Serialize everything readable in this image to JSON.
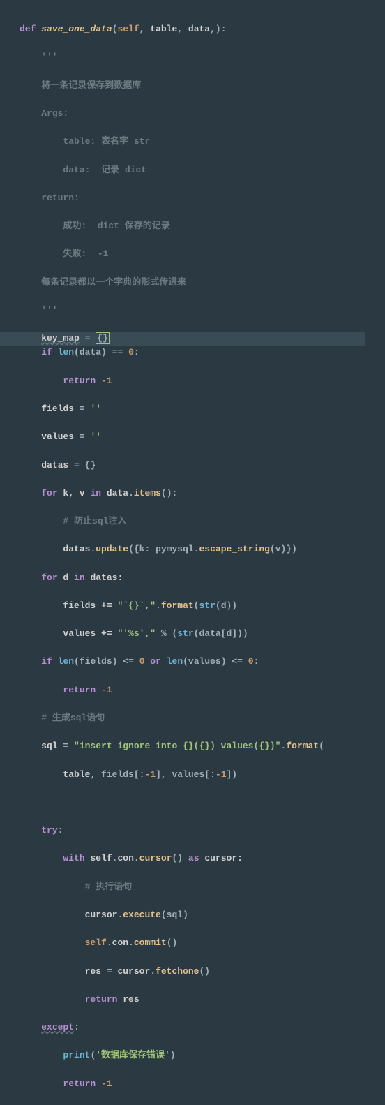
{
  "def": "def",
  "fn_name": "save_one_data",
  "params_open": "(",
  "params": "self, table, data,",
  "params_close": "):",
  "docq1": "'''",
  "doc_l1": "将一条记录保存到数据库",
  "doc_l2": "Args:",
  "doc_l3": "    table: 表名字 str",
  "doc_l4": "    data:  记录 dict",
  "doc_l5": "return:",
  "doc_l6": "    成功:  dict 保存的记录",
  "doc_l7": "    失败:  -1",
  "doc_l8": "每条记录都以一个字典的形式传进来",
  "docq2": "'''",
  "km_var": "key_map",
  "km_eq": " = ",
  "km_val": "{}",
  "if1_if": "if",
  "if1_len": "len",
  "if1_data": "(data)",
  "if1_eqeq": " == ",
  "if1_zero": "0",
  "if1_colon": ":",
  "ret_m1_kw": "return",
  "ret_m1_val": "-1",
  "fields_var": "fields",
  "eq": " = ",
  "empty_str": "''",
  "values_var": "values",
  "datas_var": "datas",
  "empty_dict": "{}",
  "for1_for": "for",
  "for1_kv": " k, v ",
  "for1_in": "in",
  "for1_data": " data",
  "for1_items": "items",
  "for1_end": "():",
  "c_sql_inj": "# 防止sql注入",
  "upd_datas": "datas",
  "upd_meth": "update",
  "upd_arg1": "({k: pymysql",
  "upd_esc": "escape_string",
  "upd_arg2": "(v)})",
  "for2_for": "for",
  "for2_d": " d ",
  "for2_in": "in",
  "for2_datas": " datas:",
  "fld_pe": "fields += ",
  "fld_str": "\"`{}`,\"",
  "fld_fmt": "format",
  "fld_strd": "(str(d))",
  "val_pe": "values += ",
  "val_str": "\"'%s',\"",
  "val_pct": " % ",
  "val_str2": "(str(data[d]))",
  "if2_if": "if",
  "if2_len1": " len",
  "if2_f": "(fields)",
  "if2_le": " <= ",
  "if2_zero": "0",
  "if2_or": " or ",
  "if2_len2": "len",
  "if2_v": "(values)",
  "if2_colon": ":",
  "c_gen_sql": "# 生成sql语句",
  "sql_var": "sql",
  "sql_str1": "\"insert ignore into {}({}) values({})\"",
  "sql_fmt": "format",
  "sql_open": "(",
  "sql_args": "table, fields[:-1], values[:-1])",
  "try_kw": "try",
  "with_kw": "with",
  "with_self": " self",
  "with_con": "con",
  "with_cur": "cursor",
  "with_as": " as ",
  "with_cv": "cursor:",
  "c_exec": "# 执行语句",
  "exec_c": "cursor",
  "exec_m": "execute",
  "exec_a": "(sql)",
  "commit_s": "self",
  "commit_c": "con",
  "commit_m": "commit",
  "commit_p": "()",
  "res_var": "res",
  "fetch_c": "cursor",
  "fetch_m": "fetchone",
  "fetch_p": "()",
  "ret_res_kw": "return",
  "ret_res_v": " res",
  "except_kw": "except",
  "except_c": ":",
  "print_fn": "print",
  "print_s": "'数据库保存错误'",
  "ret_fin_kw": "return",
  "ret_fin_v": "-1",
  "dot": ".",
  "colon": ":"
}
